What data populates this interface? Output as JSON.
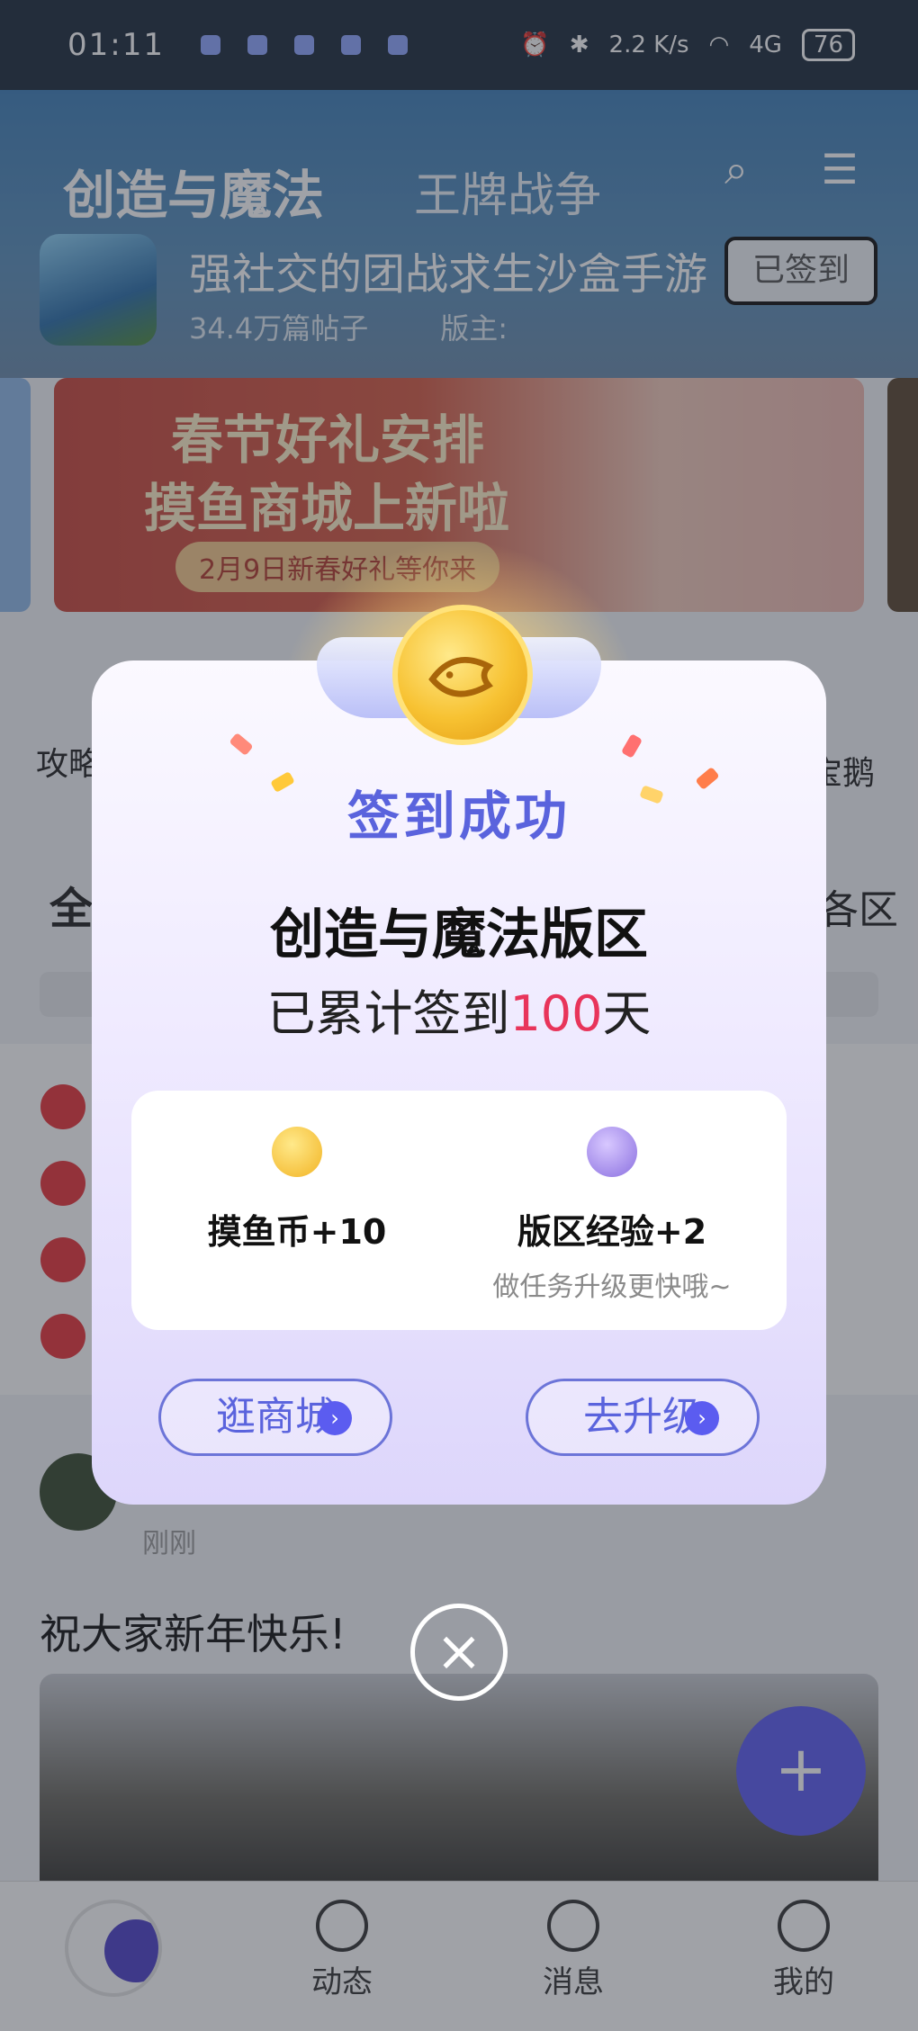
{
  "status_bar": {
    "time": "01:11",
    "net_speed": "2.2 K/s",
    "network": "4G",
    "battery": "76"
  },
  "header": {
    "tab_active": "创造与魔法",
    "tab_other": "王牌战争",
    "game_title": "强社交的团战求生沙盒手游",
    "post_count": "34.4万篇帖子",
    "moderator_label": "版主:",
    "signed_button": "已签到"
  },
  "banner": {
    "line1": "春节好礼安排",
    "line2": "摸鱼商城上新啦",
    "line3": "2月9日新春好礼等你来"
  },
  "shortcuts": {
    "left": "攻略",
    "right": "宝鹅"
  },
  "tabs": {
    "all": "全",
    "zone": "各区"
  },
  "post": {
    "time": "刚刚",
    "text": "祝大家新年快乐!"
  },
  "fab_label": "+",
  "bottom_nav": {
    "dynamic": "动态",
    "messages": "消息",
    "mine": "我的"
  },
  "dialog": {
    "title": "签到成功",
    "zone_name": "创造与魔法版区",
    "streak_prefix": "已累计签到",
    "streak_days": "100",
    "streak_suffix": "天",
    "rewards": [
      {
        "label": "摸鱼币+10",
        "icon": "fish-coin-icon",
        "color": "#f7c232"
      },
      {
        "label": "版区经验+2",
        "hint": "做任务升级更快哦~",
        "icon": "experience-badge-icon",
        "color": "#8a6fe0"
      }
    ],
    "shop_button": "逛商城",
    "upgrade_button": "去升级",
    "close_icon": "close-icon"
  },
  "colors": {
    "accent": "#5b5cf0",
    "streak_number": "#e8345a",
    "title": "#5a63dd"
  }
}
